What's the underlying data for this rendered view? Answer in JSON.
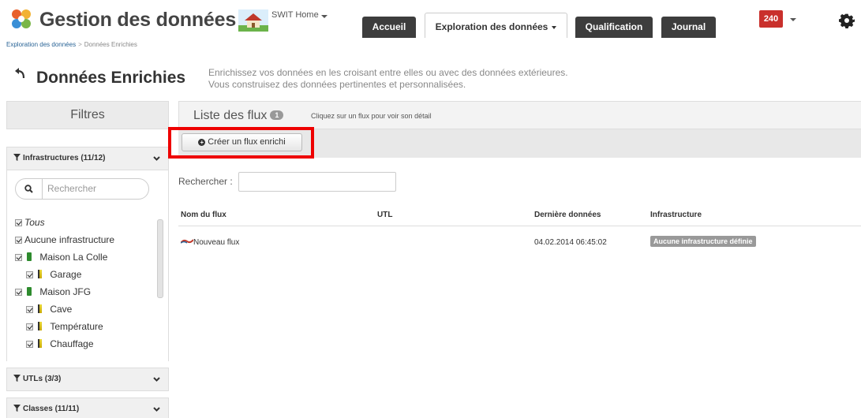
{
  "app": {
    "title": "Gestion des données",
    "home_label": "SWIT Home"
  },
  "nav": {
    "tabs": [
      {
        "label": "Accueil"
      },
      {
        "label": "Exploration des données"
      },
      {
        "label": "Qualification"
      },
      {
        "label": "Journal"
      }
    ],
    "notifications": "240"
  },
  "breadcrumb": {
    "parent": "Exploration des données",
    "separator": ">",
    "current": "Données Enrichies"
  },
  "page": {
    "title": "Données Enrichies",
    "description_line1": "Enrichissez vos données en les croisant entre elles ou avec des données extérieures.",
    "description_line2": "Vous construisez des données pertinentes et personnalisées."
  },
  "sidebar": {
    "title": "Filtres",
    "sections": [
      {
        "label": "Infrastructures (11/12)"
      },
      {
        "label": "UTLs (3/3)"
      },
      {
        "label": "Classes (11/11)"
      }
    ],
    "search_placeholder": "Rechercher",
    "tree": [
      {
        "label": "Tous"
      },
      {
        "label": "Aucune infrastructure"
      },
      {
        "label": "Maison La Colle"
      },
      {
        "label": "Garage"
      },
      {
        "label": "Maison JFG"
      },
      {
        "label": "Cave"
      },
      {
        "label": "Température"
      },
      {
        "label": "Chauffage"
      }
    ]
  },
  "main": {
    "list_title": "Liste des flux",
    "count": "1",
    "hint": "Cliquez sur un flux pour voir son détail",
    "create_button": "Créer un flux enrichi",
    "search_label": "Rechercher :",
    "columns": [
      "Nom du flux",
      "UTL",
      "Dernière données",
      "Infrastructure"
    ],
    "rows": [
      {
        "name": "Nouveau flux",
        "utl": "",
        "last": "04.02.2014 06:45:02",
        "infra": "Aucune infrastructure définie"
      }
    ]
  },
  "colors": {
    "notification": "#c9302c",
    "highlight": "#ee0000",
    "dark_tab": "#3d3d3d",
    "link": "#2a6496"
  }
}
